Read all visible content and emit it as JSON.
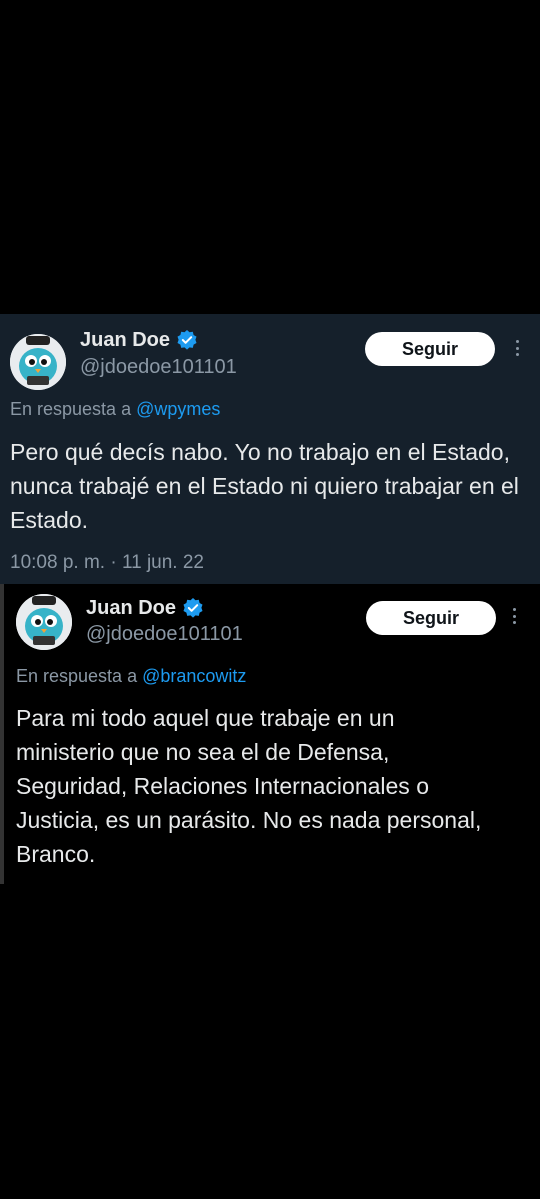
{
  "tweets": [
    {
      "display_name": "Juan Doe",
      "handle": "@jdoedoe101101",
      "follow_label": "Seguir",
      "reply_prefix": "En respuesta a ",
      "reply_to": "@wpymes",
      "text": "Pero qué decís nabo. Yo no trabajo en el Estado, nunca trabajé en el Estado ni quiero trabajar en el Estado.",
      "timestamp": "10:08 p. m. · 11 jun. 22",
      "icons": [
        "verified-icon",
        "more-icon"
      ]
    },
    {
      "display_name": "Juan Doe",
      "handle": "@jdoedoe101101",
      "follow_label": "Seguir",
      "reply_prefix": "En respuesta a ",
      "reply_to": "@brancowitz",
      "text": "Para mi todo aquel que trabaje en un ministerio que no sea el de Defensa, Seguridad, Relaciones Internacionales o Justicia, es un parásito. No es nada personal, Branco.",
      "icons": [
        "verified-icon",
        "more-icon"
      ]
    }
  ],
  "colors": {
    "background": "#000000",
    "tweet_bg_dim": "#15202b",
    "accent": "#1d9bf0",
    "text_primary": "#e7e9ea",
    "text_secondary": "#8b98a5",
    "button_bg": "#ffffff"
  }
}
